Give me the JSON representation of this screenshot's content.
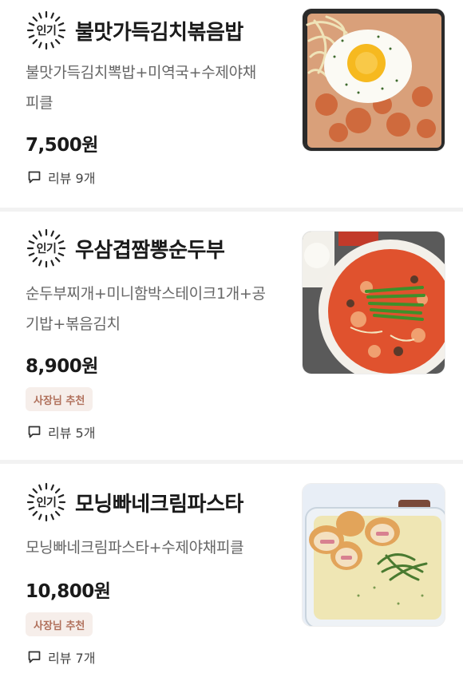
{
  "badge_popular": "인기",
  "menu_items": [
    {
      "title": "불맛가득김치볶음밥",
      "desc_line1": "불맛가득김치뽁밥+미역국+수제야채",
      "desc_line2": "피클",
      "price": "7,500원",
      "review": "리뷰 9개",
      "image_icon": "kimchi-fried-rice-image"
    },
    {
      "title": "우삼겹짬뽕순두부",
      "desc_line1": "순두부찌개+미니함박스테이크1개+공",
      "desc_line2": "기밥+볶음김치",
      "price": "8,900원",
      "recommend": "사장님 추천",
      "review": "리뷰 5개",
      "image_icon": "jjamppong-sundubu-image"
    },
    {
      "title": "모닝빠네크림파스타",
      "desc_line1": "모닝빠네크림파스타+수제야채피클",
      "price": "10,800원",
      "recommend": "사장님 추천",
      "review": "리뷰 7개",
      "image_icon": "cream-pasta-image"
    }
  ],
  "colors": {
    "recommend_bg": "#f6eeea",
    "recommend_text": "#b0705b",
    "divider": "#f2f2f2"
  }
}
